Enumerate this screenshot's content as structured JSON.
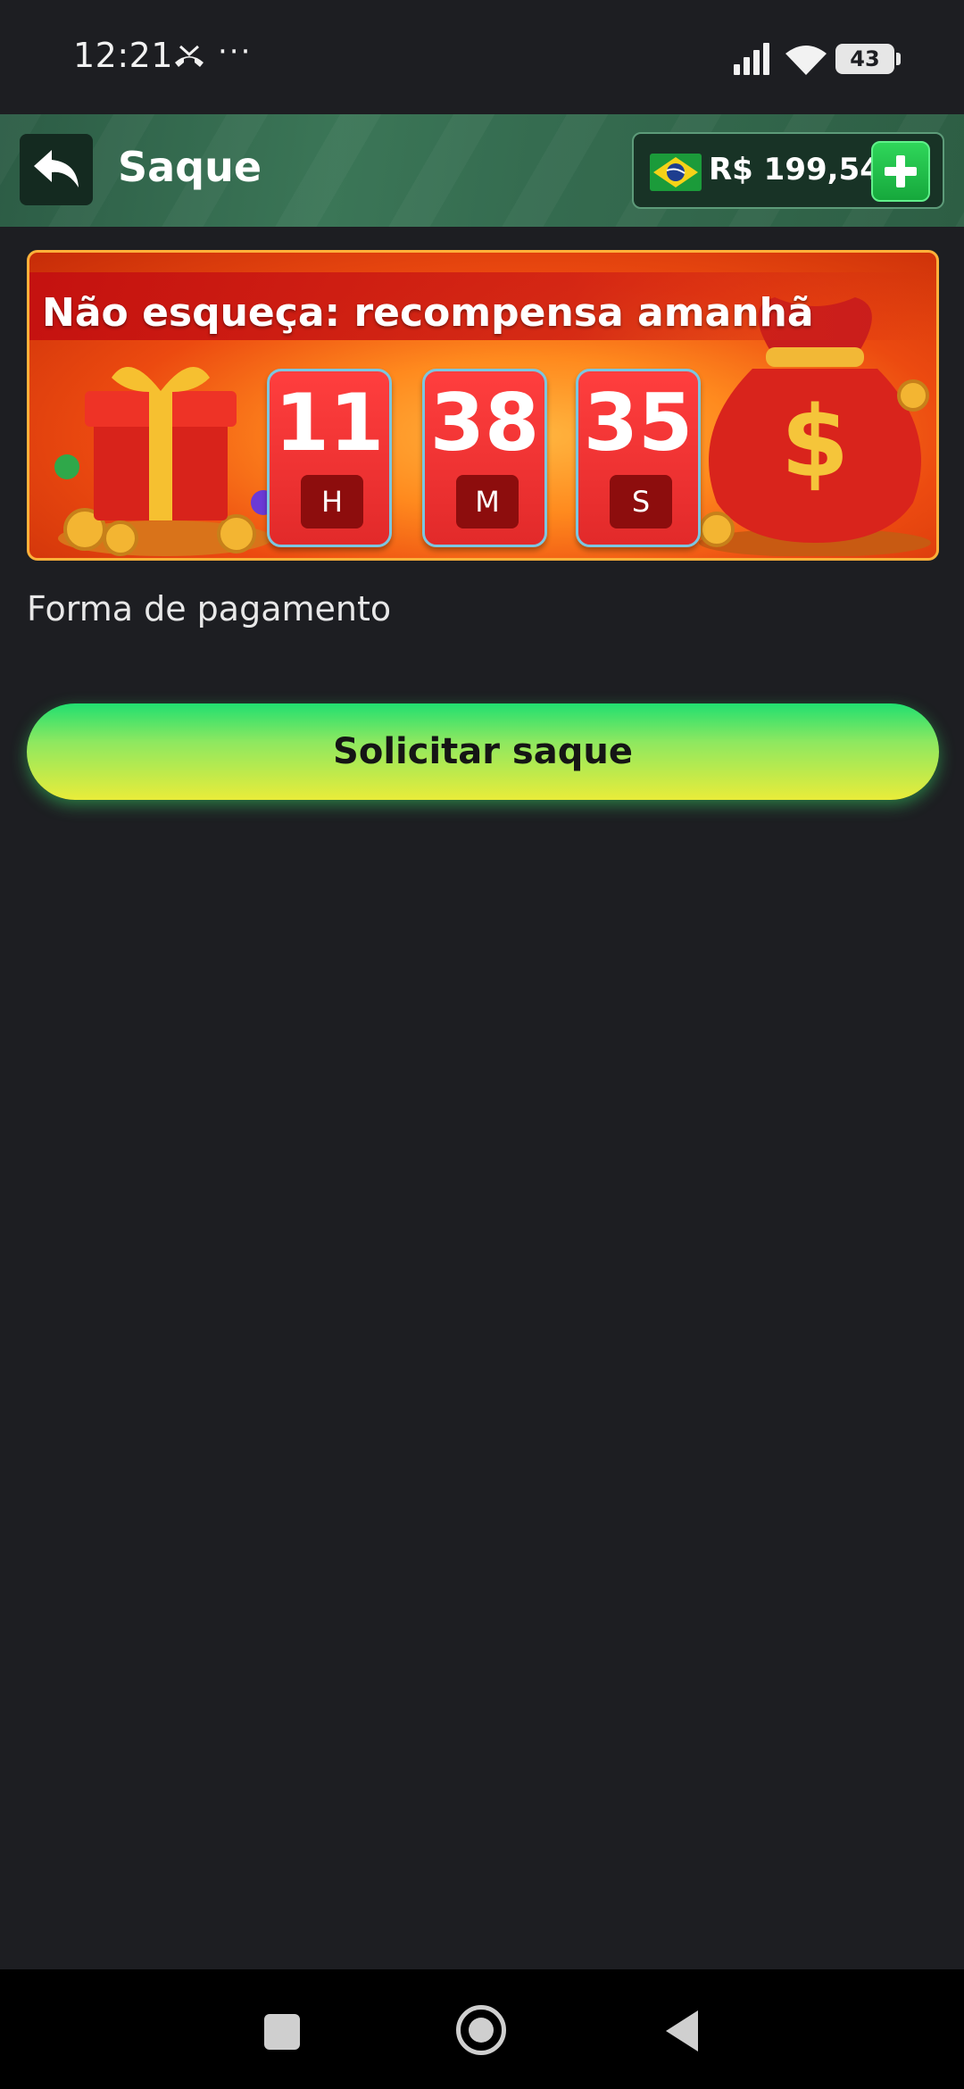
{
  "status_bar": {
    "time": "12:21",
    "dots": "···",
    "battery": "43"
  },
  "header": {
    "title": "Saque",
    "balance": "R$ 199,54"
  },
  "banner": {
    "title": "Não esqueça: recompensa amanhã",
    "countdown": [
      {
        "value": "11",
        "unit": "H"
      },
      {
        "value": "38",
        "unit": "M"
      },
      {
        "value": "35",
        "unit": "S"
      }
    ]
  },
  "form": {
    "payment_label": "Forma de pagamento",
    "submit_label": "Solicitar saque"
  },
  "colors": {
    "background": "#1d1e22",
    "header": "#356c50",
    "accent_green": "#21df70",
    "accent_yellow": "#e9ec3a",
    "timer_red": "#ff3e3e"
  },
  "icons": {
    "back": "back-arrow-icon",
    "flag": "brazil-flag-icon",
    "add": "plus-icon",
    "nav_recents": "square-icon",
    "nav_home": "circle-icon",
    "nav_back": "triangle-back-icon"
  }
}
